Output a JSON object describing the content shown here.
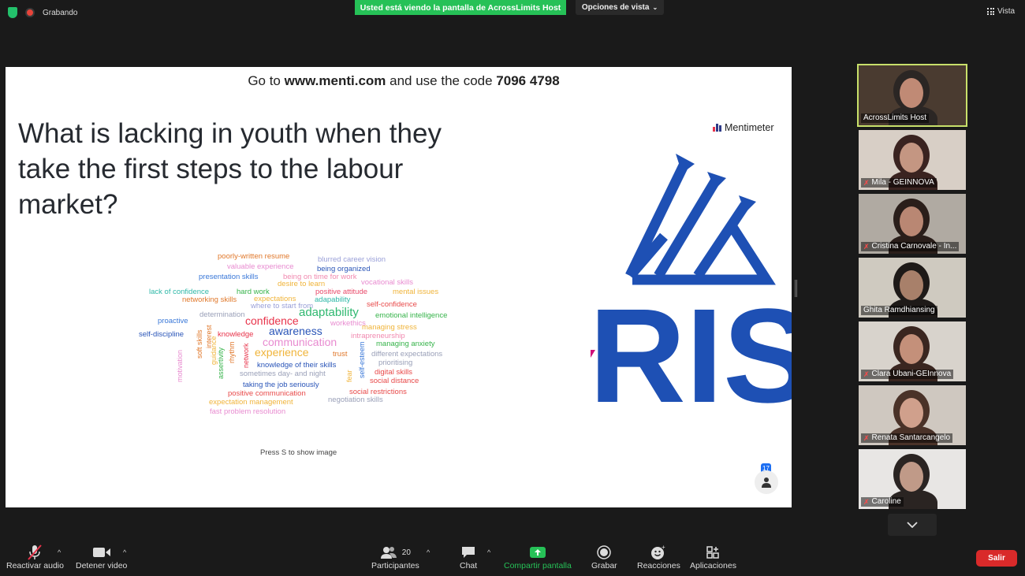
{
  "topbar": {
    "recording_label": "Grabando",
    "share_banner": "Usted está viendo la pantalla de AcrossLimits Host",
    "view_options": "Opciones de vista",
    "view_label": "Vista"
  },
  "slide": {
    "goto_prefix": "Go to ",
    "goto_url": "www.menti.com",
    "goto_middle": " and use the code ",
    "goto_code": "7096 4798",
    "question_lines": [
      "What is lacking in youth when they",
      "take the first steps to the labour",
      "market?"
    ],
    "menti_brand": "Mentimeter",
    "press_hint": "Press S to show image",
    "audience_count": "17",
    "logo_text": "RISE"
  },
  "wordcloud": [
    {
      "text": "poorly-written resume",
      "color": "#e0782b"
    },
    {
      "text": "blurred career vision",
      "color": "#9aa0d8"
    },
    {
      "text": "valuable experience",
      "color": "#e88bd0"
    },
    {
      "text": "being organized",
      "color": "#2a55b8"
    },
    {
      "text": "presentation skills",
      "color": "#3a78d8"
    },
    {
      "text": "being on time for work",
      "color": "#f18ab0"
    },
    {
      "text": "vocational skills",
      "color": "#e88bd0"
    },
    {
      "text": "desire to learn",
      "color": "#f0b43a"
    },
    {
      "text": "lack of confidence",
      "color": "#2fb8a8"
    },
    {
      "text": "hard work",
      "color": "#36b34a"
    },
    {
      "text": "positive attitude",
      "color": "#e84a6a"
    },
    {
      "text": "mental issues",
      "color": "#f0b43a"
    },
    {
      "text": "networking skills",
      "color": "#e0782b"
    },
    {
      "text": "expectations",
      "color": "#f0b43a"
    },
    {
      "text": "adapability",
      "color": "#2fb8a8"
    },
    {
      "text": "where to start from",
      "color": "#9aa0d8"
    },
    {
      "text": "self-confidence",
      "color": "#e84a4a"
    },
    {
      "text": "adaptability",
      "color": "#2fb870"
    },
    {
      "text": "determination",
      "color": "#9aa0b8"
    },
    {
      "text": "emotional intelligence",
      "color": "#36b34a"
    },
    {
      "text": "proactive",
      "color": "#3a78d8"
    },
    {
      "text": "confidence",
      "color": "#e8334a"
    },
    {
      "text": "workethics",
      "color": "#e88bd0"
    },
    {
      "text": "managing stress",
      "color": "#f0b43a"
    },
    {
      "text": "awareness",
      "color": "#2a55b8"
    },
    {
      "text": "self-discipline",
      "color": "#2a55b8"
    },
    {
      "text": "knowledge",
      "color": "#e8334a"
    },
    {
      "text": "intrapreneurship",
      "color": "#f18ab0"
    },
    {
      "text": "communication",
      "color": "#e88bd0"
    },
    {
      "text": "managing anxiety",
      "color": "#36b34a"
    },
    {
      "text": "experience",
      "color": "#f0b43a"
    },
    {
      "text": "trust",
      "color": "#e0782b"
    },
    {
      "text": "different expectations",
      "color": "#9aa0b8"
    },
    {
      "text": "prioritising",
      "color": "#9aa0b8"
    },
    {
      "text": "knowledge of their skills",
      "color": "#2a55b8"
    },
    {
      "text": "sometimes day- and night",
      "color": "#9aa0b8"
    },
    {
      "text": "digital skills",
      "color": "#e84a4a"
    },
    {
      "text": "social distance",
      "color": "#e84a4a"
    },
    {
      "text": "taking the job seriously",
      "color": "#2a55b8"
    },
    {
      "text": "positive communication",
      "color": "#e84a4a"
    },
    {
      "text": "social restrictions",
      "color": "#e84a4a"
    },
    {
      "text": "expectation management",
      "color": "#f0b43a"
    },
    {
      "text": "negotiation skills",
      "color": "#9aa0b8"
    },
    {
      "text": "fast problem resolution",
      "color": "#e88bd0"
    },
    {
      "text": "motivation",
      "color": "#e88bd0"
    },
    {
      "text": "soft skills",
      "color": "#e0782b"
    },
    {
      "text": "interest",
      "color": "#e0782b"
    },
    {
      "text": "guidance",
      "color": "#f0b43a"
    },
    {
      "text": "assertivity",
      "color": "#36b34a"
    },
    {
      "text": "rhythm",
      "color": "#e0782b"
    },
    {
      "text": "network",
      "color": "#e8334a"
    },
    {
      "text": "self-esteem",
      "color": "#3a78d8"
    },
    {
      "text": "fear",
      "color": "#f0b43a"
    }
  ],
  "participants": [
    {
      "name": "AcrossLimits Host",
      "muted": false
    },
    {
      "name": "Mila - GEINNOVA",
      "muted": true
    },
    {
      "name": "Cristina Carnovale - In...",
      "muted": true
    },
    {
      "name": "Ghita Ramdhiansing",
      "muted": false
    },
    {
      "name": "Clara Ubani-GEInnova",
      "muted": true
    },
    {
      "name": "Renata Santarcangelo",
      "muted": true
    },
    {
      "name": "Caroline",
      "muted": true
    }
  ],
  "toolbar": {
    "unmute": "Reactivar audio",
    "stop_video": "Detener video",
    "participants": "Participantes",
    "participants_count": "20",
    "chat": "Chat",
    "share": "Compartir pantalla",
    "record": "Grabar",
    "reactions": "Reacciones",
    "apps": "Aplicaciones",
    "leave": "Salir"
  },
  "colors": {
    "share_green": "#26c157",
    "leave_red": "#d92a2a",
    "active_border": "#c8e06a",
    "rise_blue": "#1e50b4"
  }
}
